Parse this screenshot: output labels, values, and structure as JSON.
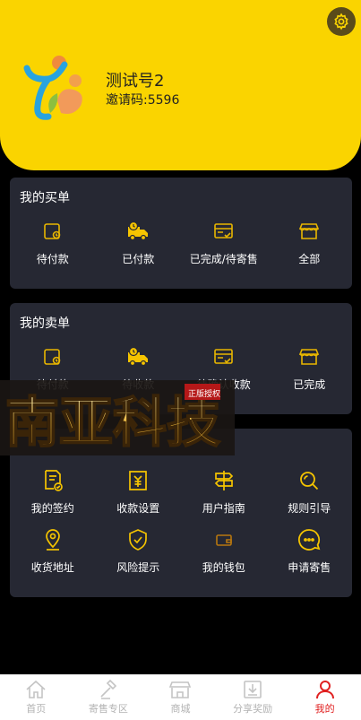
{
  "profile": {
    "name": "测试号2",
    "invite": "邀请码:5596"
  },
  "colors": {
    "accent": "#fad400",
    "card": "#262833",
    "nav_active": "#e02020",
    "nav_inactive": "#b3b3b3"
  },
  "buy": {
    "title": "我的买单",
    "items": [
      {
        "label": "待付款",
        "icon": "wallet-icon"
      },
      {
        "label": "已付款",
        "icon": "truck-icon"
      },
      {
        "label": "已完成/待寄售",
        "icon": "card-icon"
      },
      {
        "label": "全部",
        "icon": "store-icon"
      }
    ]
  },
  "sell": {
    "title": "我的卖单",
    "items": [
      {
        "label": "待付款",
        "icon": "wallet-icon"
      },
      {
        "label": "待收款",
        "icon": "truck-icon"
      },
      {
        "label": "待确认收款",
        "icon": "card-icon"
      },
      {
        "label": "已完成",
        "icon": "store-icon"
      }
    ]
  },
  "services": {
    "items": [
      {
        "label": "我的签约",
        "icon": "contract-icon"
      },
      {
        "label": "收款设置",
        "icon": "payment-icon"
      },
      {
        "label": "用户指南",
        "icon": "signpost-icon"
      },
      {
        "label": "规则引导",
        "icon": "search-icon"
      },
      {
        "label": "收货地址",
        "icon": "location-icon"
      },
      {
        "label": "风险提示",
        "icon": "shield-icon"
      },
      {
        "label": "我的钱包",
        "icon": "wallet-icon"
      },
      {
        "label": "申请寄售",
        "icon": "chat-icon"
      }
    ]
  },
  "watermark": {
    "text": "南亚科技",
    "seal": "正版授权"
  },
  "nav": {
    "items": [
      {
        "label": "首页",
        "icon": "home-icon"
      },
      {
        "label": "寄售专区",
        "icon": "hammer-icon"
      },
      {
        "label": "商城",
        "icon": "shop-icon"
      },
      {
        "label": "分享奖励",
        "icon": "share-icon"
      },
      {
        "label": "我的",
        "icon": "user-icon"
      }
    ]
  }
}
